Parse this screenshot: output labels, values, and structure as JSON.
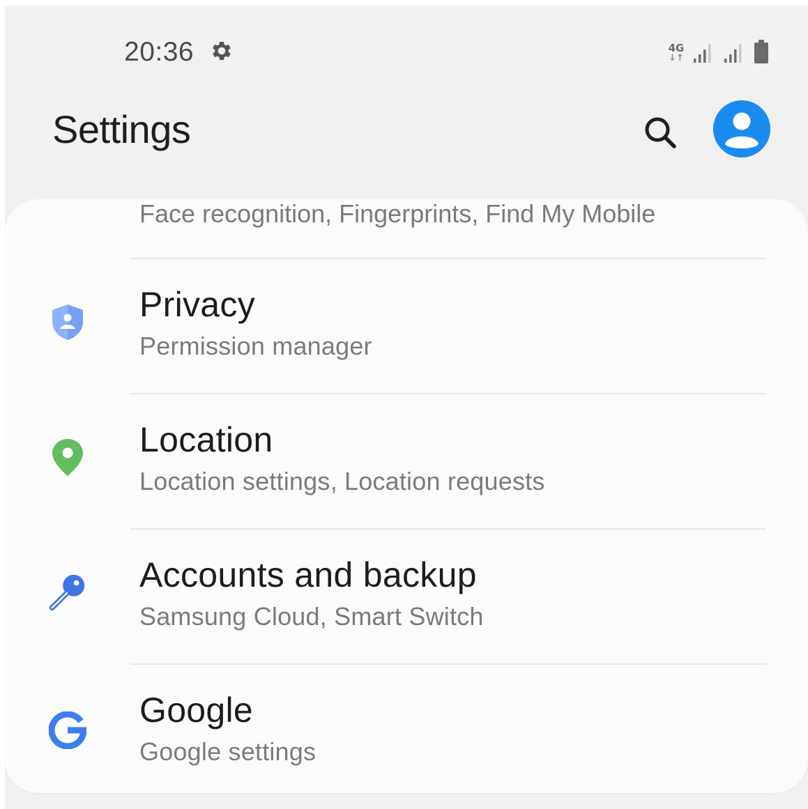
{
  "status_bar": {
    "time": "20:36",
    "network_type": "4G",
    "network_arrows": "↓↑",
    "icons": [
      "gear-icon",
      "signal-icon",
      "signal-icon",
      "battery-icon"
    ]
  },
  "header": {
    "title": "Settings",
    "search_icon": "search-icon",
    "account_icon": "account-icon",
    "accent_color": "#1a8cf0"
  },
  "list": {
    "partial_item": {
      "subtitle": "Face recognition, Fingerprints, Find My Mobile",
      "icon": "security-icon"
    },
    "items": [
      {
        "title": "Privacy",
        "subtitle": "Permission manager",
        "icon": "privacy-shield-icon",
        "icon_color": "#7aa6f5"
      },
      {
        "title": "Location",
        "subtitle": "Location settings, Location requests",
        "icon": "location-pin-icon",
        "icon_color": "#5cb85c"
      },
      {
        "title": "Accounts and backup",
        "subtitle": "Samsung Cloud, Smart Switch",
        "icon": "key-icon",
        "icon_color": "#3f6fe0"
      },
      {
        "title": "Google",
        "subtitle": "Google settings",
        "icon": "google-g-icon",
        "icon_color": "#3c7ef0"
      }
    ]
  }
}
